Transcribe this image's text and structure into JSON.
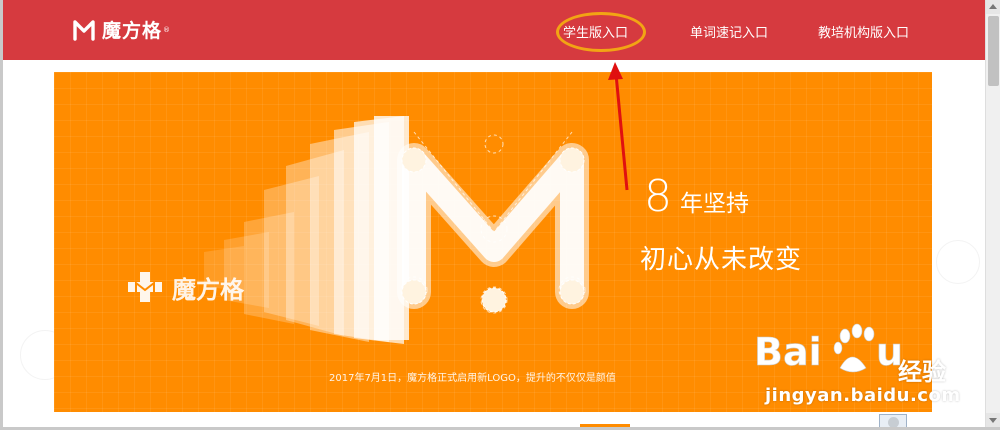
{
  "header": {
    "logo_text": "魔方格",
    "logo_reg": "®",
    "nav": {
      "student": "学生版入口",
      "word": "单词速记入口",
      "org": "教培机构版入口"
    }
  },
  "banner": {
    "brand_text": "魔方格",
    "tagline_number": "8",
    "tagline_words": "年坚持",
    "tagline_line2": "初心从未改变",
    "caption": "2017年7月1日，魔方格正式启用新LOGO，提升的不仅仅是颜值",
    "color": "#ff8c00"
  },
  "annotations": {
    "highlight_color": "#f2a414",
    "arrow_color": "#e01010"
  },
  "watermark": {
    "brand_cn": "经验",
    "url": "jingyan.baidu.com"
  },
  "colors": {
    "header": "#d63a3f",
    "accent": "#ff8c00"
  }
}
